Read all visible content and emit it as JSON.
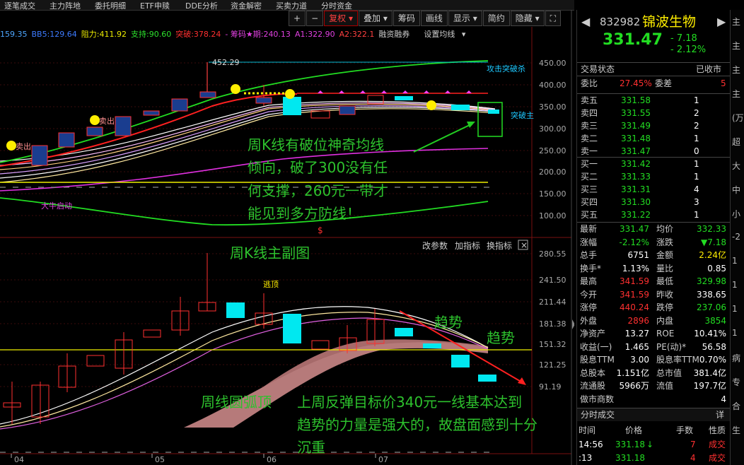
{
  "menu": [
    "逐笔成交",
    "主力阵地",
    "委托明细",
    "ETF申赎",
    "DDE分析",
    "资金解密",
    "买卖力道",
    "分时资金"
  ],
  "toolbar": {
    "plus": "+",
    "minus": "−",
    "fuquan": "复权",
    "diejia": "叠加",
    "chouma": "筹码",
    "huaxian": "画线",
    "xianshi": "显示",
    "jianyue": "简约",
    "yincang": "隐藏"
  },
  "indicators": {
    "ma1": "159.35",
    "ma2": "BB5:129.64",
    "zuli": "阻力:411.92",
    "zhichi": "支持:90.60",
    "tupo": "突破:378.24",
    "chouma_qi": "- 筹码★期:240.13",
    "a1": "A1:322.90",
    "a2": "A2:322.1",
    "rongzi": "融资融券",
    "shezhi": "设置均线"
  },
  "main_chart": {
    "price_axis": [
      "450.00",
      "400.00",
      "350.00",
      "300.00",
      "250.00",
      "200.00",
      "150.00",
      "100.00"
    ],
    "high_label": "452.29",
    "labels": {
      "gongji": "攻击突破杀",
      "tupo": "突破主",
      "tupo2": "突破(",
      "chu1": "卖出",
      "chu2": "卖出",
      "daniu": "大牛启动",
      "dollar": "$"
    }
  },
  "sub_chart": {
    "title_links": {
      "gaicanshu": "改参数",
      "jiazhibiao": "加指标",
      "huanzhibiao": "换指标",
      "close": "×"
    },
    "price_axis": [
      "280.55",
      "241.50",
      "211.44",
      "181.38",
      "151.32",
      "121.25",
      "91.19"
    ],
    "top_label": "逃顶"
  },
  "x_axis": [
    "04",
    "05",
    "06",
    "07"
  ],
  "annotations": {
    "a1": "周K线有破位神奇均线",
    "a2": "倾向，破了300没有任",
    "a3": "何支撑，260元一带才",
    "a4": "能见到多方防线！",
    "a5": "周K线主副图",
    "a6": "趋势",
    "a7": "趋势",
    "a8": "周线圆弧顶",
    "a9": "上周反弹目标价340元一线基本达到",
    "a10": "趋势的力量是强大的，故盘面感到十分",
    "a11": "沉重"
  },
  "quote": {
    "code": "832982",
    "name": "锦波生物",
    "price": "331.47",
    "change": "- 7.18",
    "pct": "- 2.12%",
    "status_label": "交易状态",
    "status": "已收市",
    "weibi_label": "委比",
    "weibi": "27.45%",
    "weicha_label": "委差",
    "weicha": "5",
    "asks": [
      {
        "n": "卖五",
        "p": "331.58",
        "v": "1"
      },
      {
        "n": "卖四",
        "p": "331.55",
        "v": "2"
      },
      {
        "n": "卖三",
        "p": "331.49",
        "v": "2"
      },
      {
        "n": "卖二",
        "p": "331.48",
        "v": "1"
      },
      {
        "n": "卖一",
        "p": "331.47",
        "v": "0"
      }
    ],
    "bids": [
      {
        "n": "买一",
        "p": "331.42",
        "v": "1"
      },
      {
        "n": "买二",
        "p": "331.33",
        "v": "1"
      },
      {
        "n": "买三",
        "p": "331.31",
        "v": "4"
      },
      {
        "n": "买四",
        "p": "331.30",
        "v": "3"
      },
      {
        "n": "买五",
        "p": "331.22",
        "v": "1"
      }
    ],
    "stats": [
      [
        "最新",
        "331.47",
        "均价",
        "332.33"
      ],
      [
        "涨幅",
        "-2.12%",
        "涨跌",
        "▼7.18"
      ],
      [
        "总手",
        "6751",
        "金额",
        "2.24亿"
      ],
      [
        "换手*",
        "1.13%",
        "量比",
        "0.85"
      ],
      [
        "最高",
        "341.59",
        "最低",
        "329.98"
      ],
      [
        "今开",
        "341.59",
        "昨收",
        "338.65"
      ],
      [
        "涨停",
        "440.24",
        "跌停",
        "237.06"
      ],
      [
        "外盘",
        "2896",
        "内盘",
        "3854"
      ],
      [
        "净资产",
        "13.27",
        "ROE",
        "10.41%"
      ],
      [
        "收益(一)",
        "1.465",
        "PE(动)*",
        "56.58"
      ],
      [
        "股息TTM",
        "3.00",
        "股息率TTM",
        "0.70%"
      ],
      [
        "总股本",
        "1.151亿",
        "总市值",
        "381.4亿"
      ],
      [
        "流通股",
        "5966万",
        "流值",
        "197.7亿"
      ],
      [
        "做市商数",
        "",
        "",
        "4"
      ]
    ],
    "fenshi_title": "分时成交",
    "fenshi_more": "详",
    "fenshi_head": [
      "时间",
      "价格",
      "手数",
      "性质"
    ],
    "trades": [
      {
        "t": "14:56",
        "p": "331.18",
        "arrow": "↓",
        "v": "7",
        "x": "成交"
      },
      {
        "t": ":13",
        "p": "331.18",
        "arrow": "",
        "v": "4",
        "x": "成交"
      }
    ]
  },
  "far_right": [
    "主",
    "主",
    "主",
    "主",
    "(万",
    "超",
    "大",
    "中",
    "小",
    "-2",
    "1",
    "1",
    "1",
    "1",
    "病",
    "专",
    "合",
    "生"
  ]
}
